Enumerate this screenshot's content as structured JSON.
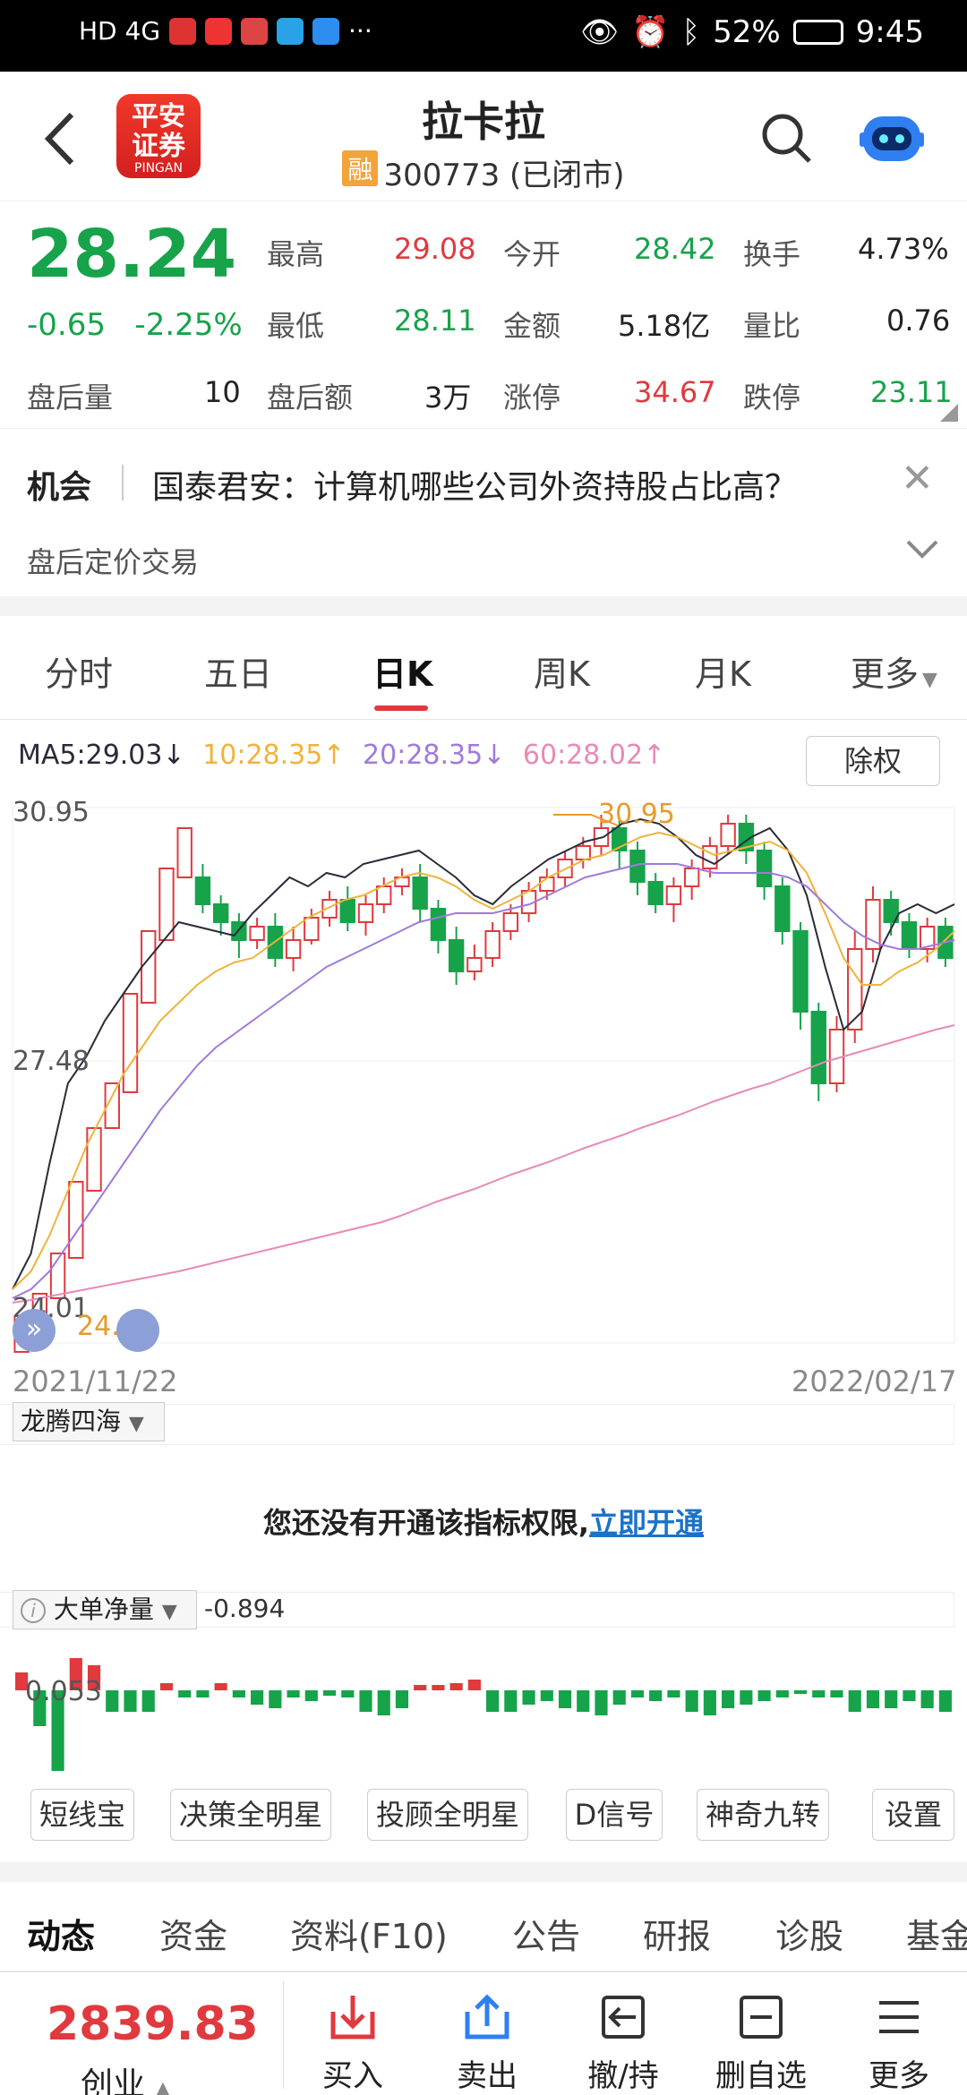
{
  "status_bar": {
    "left_icons": "HD 4G",
    "battery": "52%",
    "time": "9:45"
  },
  "header": {
    "logo_line1": "平安",
    "logo_line2": "证券",
    "logo_sub": "PINGAN",
    "title": "拉卡拉",
    "tag": "融",
    "code_status": "300773 (已闭市)"
  },
  "quote": {
    "price": "28.24",
    "change": "-0.65",
    "change_pct": "-2.25%",
    "after_vol_label": "盘后量",
    "after_vol": "10",
    "high_label": "最高",
    "high": "29.08",
    "low_label": "最低",
    "low": "28.11",
    "after_amt_label": "盘后额",
    "after_amt": "3万",
    "open_label": "今开",
    "open": "28.42",
    "amount_label": "金额",
    "amount": "5.18亿",
    "limit_up_label": "涨停",
    "limit_up": "34.67",
    "turnover_label": "换手",
    "turnover": "4.73%",
    "vol_ratio_label": "量比",
    "vol_ratio": "0.76",
    "limit_down_label": "跌停",
    "limit_down": "23.11"
  },
  "news": {
    "tag": "机会",
    "headline": "国泰君安：计算机哪些公司外资持股占比高？",
    "sub": "盘后定价交易"
  },
  "tabs": [
    "分时",
    "五日",
    "日K",
    "周K",
    "月K",
    "更多"
  ],
  "chart": {
    "ma5": "MA5:29.03↓",
    "ma10": "10:28.35↑",
    "ma20": "20:28.35↓",
    "ma60": "60:28.02↑",
    "chuquan": "除权",
    "y_high": "30.95",
    "y_mid": "27.48",
    "y_low": "24.01",
    "max_mark": "30.95",
    "min_mark": "24.01",
    "start_date": "2021/11/22",
    "end_date": "2022/02/17",
    "colors": {
      "up": "#e0393e",
      "down": "#16a34a",
      "ma5": "#2a2a3a",
      "ma10": "#f0b33a",
      "ma20": "#a07adc",
      "ma60": "#e88ab8"
    }
  },
  "indicator1": {
    "name": "龙腾四海",
    "locked_text": "您还没有开通该指标权限,",
    "locked_link": "立即开通"
  },
  "indicator2": {
    "name": "大单净量",
    "value": "-0.894",
    "level": "0.053"
  },
  "toolbar": [
    "短线宝",
    "决策全明星",
    "投顾全明星",
    "D信号",
    "神奇九转",
    "设置"
  ],
  "bottom_tabs": [
    "动态",
    "资金",
    "资料(F10)",
    "公告",
    "研报",
    "诊股",
    "基金"
  ],
  "footer": {
    "index_value": "2839.83",
    "index_name": "创业",
    "buy": "买入",
    "sell": "卖出",
    "cancel": "撤/持",
    "remove": "删自选",
    "more": "更多"
  }
}
